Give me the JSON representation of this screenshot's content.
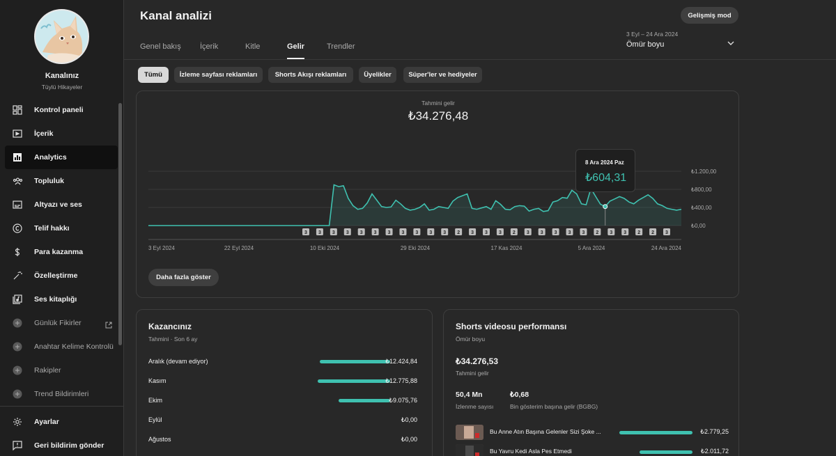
{
  "sidebar": {
    "channel_name": "Kanalınız",
    "channel_sub": "Tüylü Hikayeler",
    "items": [
      {
        "label": "Kontrol paneli",
        "icon": "dashboard-icon"
      },
      {
        "label": "İçerik",
        "icon": "content-icon"
      },
      {
        "label": "Analytics",
        "icon": "analytics-icon",
        "active": true
      },
      {
        "label": "Topluluk",
        "icon": "community-icon"
      },
      {
        "label": "Altyazı ve ses",
        "icon": "subtitles-icon"
      },
      {
        "label": "Telif hakkı",
        "icon": "copyright-icon"
      },
      {
        "label": "Para kazanma",
        "icon": "dollar-icon"
      },
      {
        "label": "Özelleştirme",
        "icon": "magic-wand-icon"
      },
      {
        "label": "Ses kitaplığı",
        "icon": "audio-library-icon"
      },
      {
        "label": "Günlük Fikirler",
        "icon": "plugin-icon",
        "external": true
      },
      {
        "label": "Anahtar Kelime Kontrolü",
        "icon": "plugin-icon"
      },
      {
        "label": "Rakipler",
        "icon": "plugin-icon"
      },
      {
        "label": "Trend Bildirimleri",
        "icon": "plugin-icon"
      }
    ],
    "bottom": [
      {
        "label": "Ayarlar",
        "icon": "gear-icon"
      },
      {
        "label": "Geri bildirim gönder",
        "icon": "feedback-icon"
      }
    ]
  },
  "header": {
    "title": "Kanal analizi",
    "advanced_mode": "Gelişmiş mod",
    "tabs": [
      "Genel bakış",
      "İçerik",
      "Kitle",
      "Gelir",
      "Trendler"
    ],
    "active_tab": "Gelir",
    "date_range": "3 Eyl – 24 Ara 2024",
    "date_label": "Ömür boyu"
  },
  "chips": [
    "Tümü",
    "İzleme sayfası reklamları",
    "Shorts Akışı reklamları",
    "Üyelikler",
    "Süper'ler ve hediyeler"
  ],
  "revenue": {
    "label": "Tahmini gelir",
    "value": "₺34.276,48",
    "more_button": "Daha fazla göster",
    "tooltip": {
      "date": "8 Ara 2024 Paz",
      "value": "₺604,31"
    }
  },
  "chart_data": {
    "type": "area",
    "title": "Tahmini gelir",
    "x_labels": [
      "3 Eyl 2024",
      "22 Eyl 2024",
      "10 Eki 2024",
      "29 Eki 2024",
      "17 Kas 2024",
      "5 Ara 2024",
      "24 Ara 2024"
    ],
    "y_ticks": [
      "₺1.200,00",
      "₺800,00",
      "₺400,00",
      "₺0,00"
    ],
    "ylim": [
      0,
      1200
    ],
    "x": [
      "2024-09-03",
      "2024-09-10",
      "2024-09-17",
      "2024-09-24",
      "2024-10-01",
      "2024-10-08",
      "2024-10-11",
      "2024-10-12",
      "2024-10-13",
      "2024-10-14",
      "2024-10-15",
      "2024-10-16",
      "2024-10-17",
      "2024-10-18",
      "2024-10-19",
      "2024-10-20",
      "2024-10-21",
      "2024-10-22",
      "2024-10-23",
      "2024-10-24",
      "2024-10-25",
      "2024-10-26",
      "2024-10-27",
      "2024-10-28",
      "2024-10-29",
      "2024-10-30",
      "2024-10-31",
      "2024-11-01",
      "2024-11-02",
      "2024-11-03",
      "2024-11-04",
      "2024-11-05",
      "2024-11-06",
      "2024-11-07",
      "2024-11-08",
      "2024-11-09",
      "2024-11-10",
      "2024-11-11",
      "2024-11-12",
      "2024-11-13",
      "2024-11-14",
      "2024-11-15",
      "2024-11-16",
      "2024-11-17",
      "2024-11-18",
      "2024-11-19",
      "2024-11-20",
      "2024-11-21",
      "2024-11-22",
      "2024-11-23",
      "2024-11-24",
      "2024-11-25",
      "2024-11-26",
      "2024-11-27",
      "2024-11-28",
      "2024-11-29",
      "2024-11-30",
      "2024-12-01",
      "2024-12-02",
      "2024-12-03",
      "2024-12-04",
      "2024-12-05",
      "2024-12-06",
      "2024-12-07",
      "2024-12-08",
      "2024-12-09",
      "2024-12-10",
      "2024-12-11",
      "2024-12-12",
      "2024-12-13",
      "2024-12-14",
      "2024-12-15",
      "2024-12-16",
      "2024-12-17",
      "2024-12-18",
      "2024-12-19",
      "2024-12-20",
      "2024-12-21",
      "2024-12-22",
      "2024-12-23",
      "2024-12-24"
    ],
    "values": [
      0,
      0,
      0,
      0,
      0,
      0,
      0,
      900,
      860,
      880,
      600,
      440,
      360,
      380,
      500,
      700,
      560,
      420,
      400,
      410,
      560,
      480,
      380,
      340,
      360,
      400,
      480,
      340,
      360,
      420,
      400,
      380,
      540,
      620,
      660,
      700,
      380,
      360,
      390,
      420,
      360,
      550,
      470,
      360,
      350,
      420,
      440,
      430,
      320,
      360,
      380,
      310,
      330,
      520,
      550,
      620,
      605,
      780,
      700,
      480,
      460,
      820,
      640,
      470,
      420,
      540,
      590,
      640,
      600,
      520,
      480,
      560,
      620,
      680,
      600,
      480,
      440,
      380,
      360,
      340,
      360
    ],
    "annotation_badges": [
      "3",
      "3",
      "3",
      "3",
      "3",
      "3",
      "3",
      "3",
      "3",
      "3",
      "3",
      "2",
      "3",
      "3",
      "3",
      "2",
      "3",
      "3",
      "3",
      "3",
      "3",
      "2",
      "3",
      "3",
      "2",
      "2",
      "3"
    ],
    "grid": true,
    "legend": "none"
  },
  "earnings": {
    "title": "Kazancınız",
    "subtitle": "Tahmini · Son 6 ay",
    "rows": [
      {
        "month": "Aralık (devam ediyor)",
        "value": "₺12.424,84",
        "amount": 12424.84
      },
      {
        "month": "Kasım",
        "value": "₺12.775,88",
        "amount": 12775.88
      },
      {
        "month": "Ekim",
        "value": "₺9.075,76",
        "amount": 9075.76
      },
      {
        "month": "Eylül",
        "value": "₺0,00",
        "amount": 0
      },
      {
        "month": "Ağustos",
        "value": "₺0,00",
        "amount": 0
      }
    ]
  },
  "shorts": {
    "title": "Shorts videosu performansı",
    "subtitle": "Ömür boyu",
    "revenue_value": "₺34.276,53",
    "revenue_label": "Tahmini gelir",
    "views_value": "50,4 Mn",
    "views_label": "İzlenme sayısı",
    "rpm_value": "₺0,68",
    "rpm_label": "Bin gösterim başına gelir (BGBG)",
    "videos": [
      {
        "title": "Bu Anne Atın Başına Gelenler Sizi Şoke ...",
        "value": "₺2.779,25",
        "amount": 2779.25
      },
      {
        "title": "Bu Yavru Kedi Asla Pes Etmedi",
        "value": "₺2.011,72",
        "amount": 2011.72
      }
    ]
  },
  "colors": {
    "accent": "#3fc1b0",
    "bg": "#282828",
    "sidebar": "#1f1f1f"
  }
}
